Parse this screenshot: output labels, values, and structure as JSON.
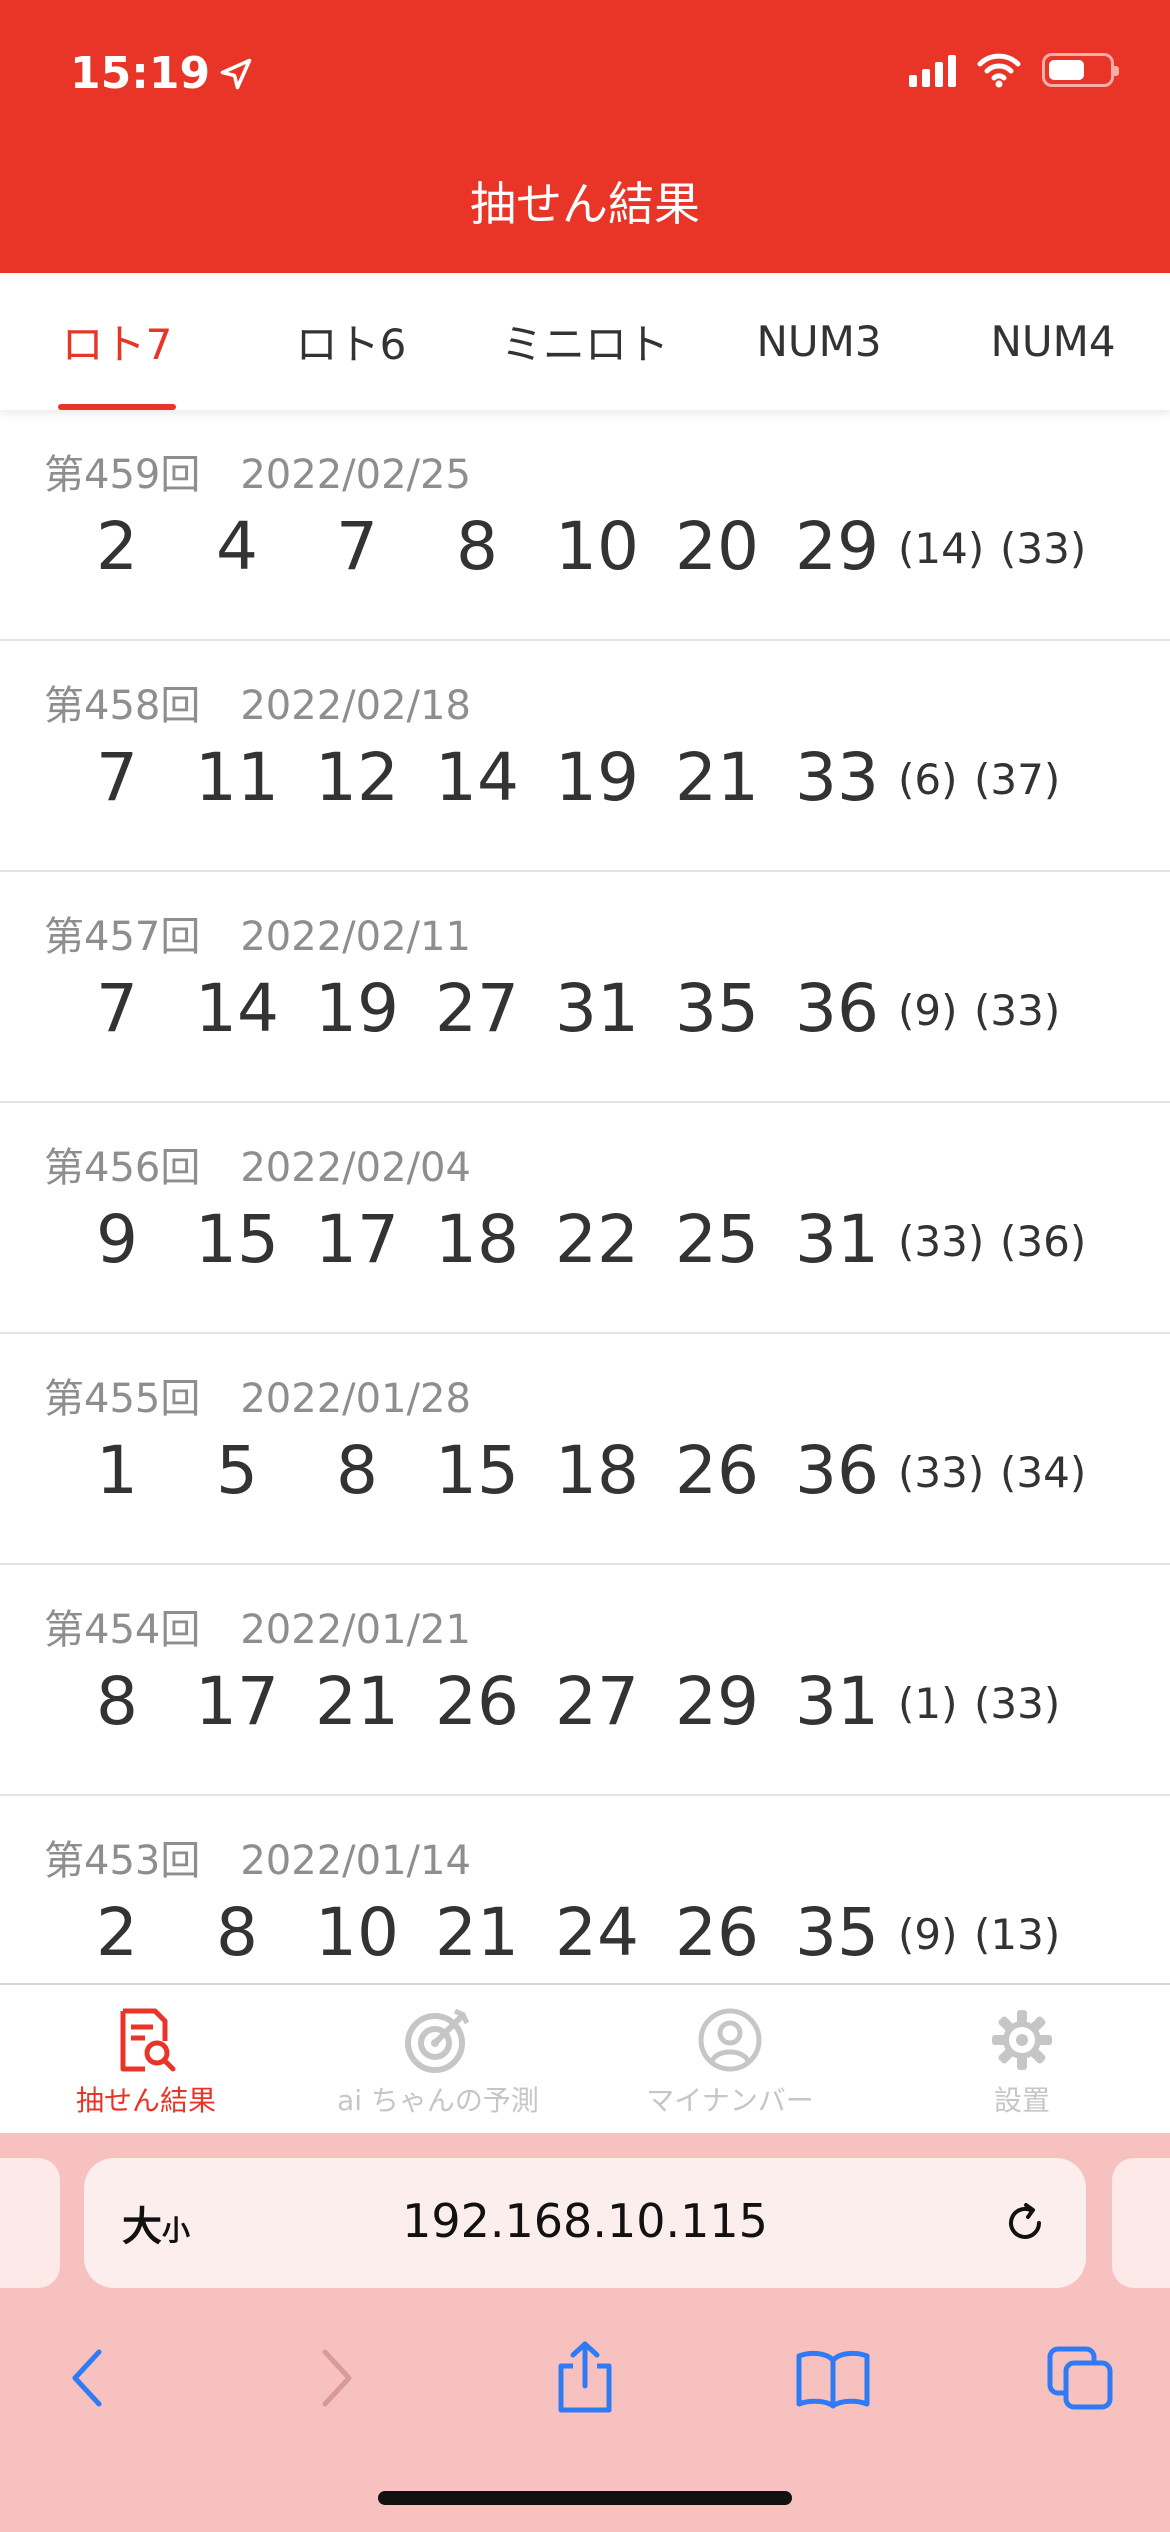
{
  "status": {
    "time": "15:19"
  },
  "header": {
    "title": "抽せん結果"
  },
  "tabs": [
    {
      "label": "ロト7",
      "active": true
    },
    {
      "label": "ロト6",
      "active": false
    },
    {
      "label": "ミニロト",
      "active": false
    },
    {
      "label": "NUM3",
      "active": false
    },
    {
      "label": "NUM4",
      "active": false
    }
  ],
  "results": [
    {
      "round": "第459回",
      "date": "2022/02/25",
      "numbers": [
        "2",
        "4",
        "7",
        "8",
        "10",
        "20",
        "29"
      ],
      "bonus": [
        "(14)",
        "(33)"
      ]
    },
    {
      "round": "第458回",
      "date": "2022/02/18",
      "numbers": [
        "7",
        "11",
        "12",
        "14",
        "19",
        "21",
        "33"
      ],
      "bonus": [
        "(6)",
        "(37)"
      ]
    },
    {
      "round": "第457回",
      "date": "2022/02/11",
      "numbers": [
        "7",
        "14",
        "19",
        "27",
        "31",
        "35",
        "36"
      ],
      "bonus": [
        "(9)",
        "(33)"
      ]
    },
    {
      "round": "第456回",
      "date": "2022/02/04",
      "numbers": [
        "9",
        "15",
        "17",
        "18",
        "22",
        "25",
        "31"
      ],
      "bonus": [
        "(33)",
        "(36)"
      ]
    },
    {
      "round": "第455回",
      "date": "2022/01/28",
      "numbers": [
        "1",
        "5",
        "8",
        "15",
        "18",
        "26",
        "36"
      ],
      "bonus": [
        "(33)",
        "(34)"
      ]
    },
    {
      "round": "第454回",
      "date": "2022/01/21",
      "numbers": [
        "8",
        "17",
        "21",
        "26",
        "27",
        "29",
        "31"
      ],
      "bonus": [
        "(1)",
        "(33)"
      ]
    },
    {
      "round": "第453回",
      "date": "2022/01/14",
      "numbers": [
        "2",
        "8",
        "10",
        "21",
        "24",
        "26",
        "35"
      ],
      "bonus": [
        "(9)",
        "(13)"
      ]
    }
  ],
  "tabbar": [
    {
      "label": "抽せん結果",
      "icon": "results-doc-icon",
      "active": true
    },
    {
      "label": "ai ちゃんの予測",
      "icon": "target-icon",
      "active": false
    },
    {
      "label": "マイナンバー",
      "icon": "user-circle-icon",
      "active": false
    },
    {
      "label": "設置",
      "icon": "gear-icon",
      "active": false
    }
  ],
  "browser": {
    "text_size_label_big": "大",
    "text_size_label_small": "小",
    "url": "192.168.10.115"
  },
  "colors": {
    "accent": "#e93527",
    "safari_bg": "#f7c1c0",
    "safari_icon": "#2f7bf5"
  }
}
